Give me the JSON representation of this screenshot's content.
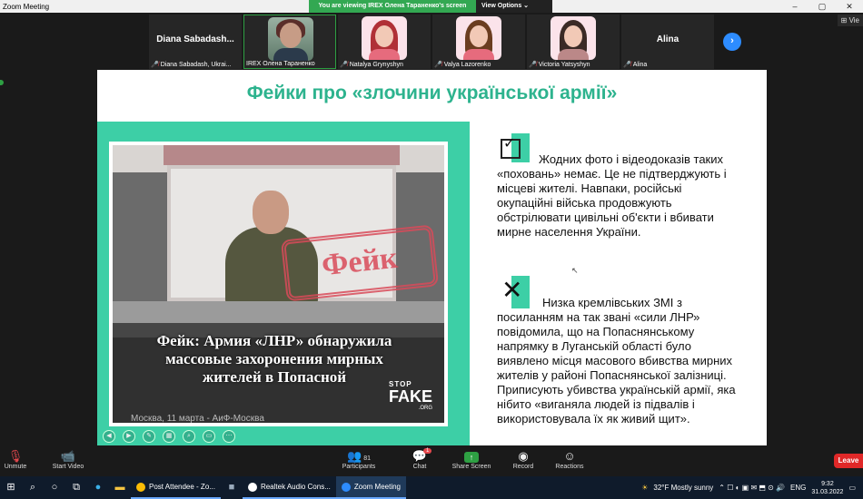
{
  "window": {
    "title": "Zoom Meeting",
    "controls": [
      "–",
      "▢",
      "✕"
    ]
  },
  "share_banner": {
    "text": "You are viewing IREX Олена Тараненко's screen",
    "view_options": "View Options ⌄"
  },
  "view_button": "⊞ Vie",
  "participants_strip": [
    {
      "big_name": "Diana  Sabadash...",
      "caption": "Diana Sabadash, Ukrai...",
      "muted": true,
      "video": false
    },
    {
      "big_name": "",
      "caption": "IREX Олена Тараненко",
      "muted": false,
      "video": true,
      "active": true
    },
    {
      "big_name": "",
      "caption": "Natalya Grynyshyn",
      "muted": true,
      "video": true
    },
    {
      "big_name": "",
      "caption": "Valya Lazorenko",
      "muted": true,
      "video": true
    },
    {
      "big_name": "",
      "caption": "Victoria Yatsyshyn",
      "muted": true,
      "video": true
    },
    {
      "big_name": "Alina",
      "caption": "Alina",
      "muted": true,
      "video": false
    }
  ],
  "slide": {
    "title": "Фейки про «злочини української армії»",
    "photo": {
      "stamp": "Фейк",
      "caption": "Фейк: Армия «ЛНР» обнаружила массовые захоронения мирных жителей в Попасной",
      "logo_stop": "STOP",
      "logo_fake": "FAKE",
      "logo_org": ".ORG",
      "footer": "Москва, 11 марта - АиФ-Москва"
    },
    "paragraph_true": "Жодних фото і відеодоказів таких «поховань» немає. Це не підтверджують і місцеві жителі. Навпаки, російські окупаційні війська продовжують обстрілювати цивільні об'єкти і вбивати мирне населення України.",
    "paragraph_fake": "Низка кремлівських ЗМІ з посиланням на так звані «сили ЛНР» повідомила, що на Попаснянському напрямку в Луганській області було виявлено місця масового вбивства мирних жителів у районі Попаснянської залізниці. Приписують убивства українській армії, яка нібито «виганяла людей із підвалів і використовувала їх як живий щит»."
  },
  "toolbar": {
    "unmute": "Unmute",
    "start_video": "Start Video",
    "participants": "Participants",
    "participants_count": "81",
    "chat": "Chat",
    "chat_badge": "1",
    "share_screen": "Share Screen",
    "record": "Record",
    "reactions": "Reactions",
    "leave": "Leave"
  },
  "taskbar": {
    "apps": [
      {
        "label": "Post Attendee - Zo...",
        "color": "#fbbc05"
      },
      {
        "label": "Realtek Audio Cons...",
        "color": "#ffffff"
      },
      {
        "label": "Zoom Meeting",
        "color": "#2d8cff"
      }
    ],
    "weather": "32°F  Mostly sunny",
    "lang": "ENG",
    "time": "9:32",
    "date": "31.03.2022"
  },
  "colors": {
    "accent_teal": "#3dcfa6",
    "title_teal": "#2db38e",
    "zoom_blue": "#2d8cff",
    "leave_red": "#e02828",
    "share_green": "#2ea043"
  }
}
